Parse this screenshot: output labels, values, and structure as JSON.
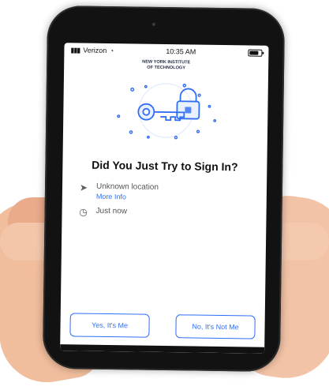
{
  "status": {
    "carrier": "Verizon",
    "time": "10:35 AM"
  },
  "logo": {
    "text": "NEW YORK INSTITUTE\nOF TECHNOLOGY"
  },
  "title": "Did You Just Try to Sign In?",
  "details": {
    "location": "Unknown location",
    "more_info": "More Info",
    "time": "Just now"
  },
  "buttons": {
    "yes": "Yes, It's Me",
    "no": "No, It's Not Me"
  },
  "colors": {
    "accent": "#2f6df6",
    "nav": "#1f2a44"
  },
  "icons": {
    "location": "location-arrow-icon",
    "clock": "clock-icon",
    "key": "key-icon",
    "lock": "lock-icon"
  }
}
